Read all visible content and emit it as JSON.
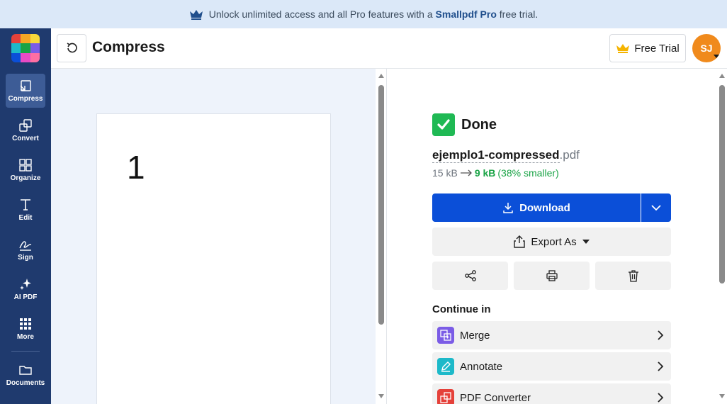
{
  "banner": {
    "text_before": "Unlock unlimited access and all Pro features with a",
    "brand": "Smallpdf Pro",
    "text_after": "free trial."
  },
  "sidebar": {
    "items": [
      {
        "label": "Compress",
        "icon": "compress-icon",
        "active": true
      },
      {
        "label": "Convert",
        "icon": "convert-icon",
        "active": false
      },
      {
        "label": "Organize",
        "icon": "organize-icon",
        "active": false
      },
      {
        "label": "Edit",
        "icon": "edit-icon",
        "active": false
      },
      {
        "label": "Sign",
        "icon": "sign-icon",
        "active": false
      },
      {
        "label": "AI PDF",
        "icon": "sparkle-icon",
        "active": false
      },
      {
        "label": "More",
        "icon": "grid-icon",
        "active": false
      },
      {
        "label": "Documents",
        "icon": "folder-icon",
        "active": false
      }
    ]
  },
  "topbar": {
    "title": "Compress",
    "trial_label": "Free Trial",
    "avatar_initials": "SJ"
  },
  "preview": {
    "page_number": "1"
  },
  "result": {
    "status": "Done",
    "file_base": "ejemplo1-compressed",
    "file_ext": ".pdf",
    "original_size": "15 kB",
    "new_size": "9 kB",
    "reduction": "(38% smaller)",
    "download_label": "Download",
    "export_label": "Export As"
  },
  "continue": {
    "heading": "Continue in",
    "tools": [
      {
        "label": "Merge",
        "icon": "merge-icon",
        "color": "#7b5ce6"
      },
      {
        "label": "Annotate",
        "icon": "pencil-icon",
        "color": "#1db9c9"
      },
      {
        "label": "PDF Converter",
        "icon": "converter-icon",
        "color": "#e5413a"
      }
    ]
  },
  "colors": {
    "sidebar": "#1f3a6e",
    "primary": "#0b4fd8",
    "success": "#1fb954",
    "avatar": "#f08a1c"
  }
}
